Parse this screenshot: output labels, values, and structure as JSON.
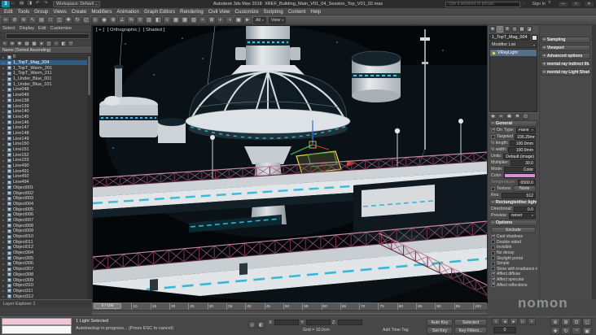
{
  "titlebar": {
    "workspace_label": "Workspace: Default",
    "app_title": "Autodesk 3ds Max 2018",
    "file_name": "XREF_Building_Main_V01_04_Session_Top_V01_02.max",
    "search_placeholder": "Type a keyword or phrase",
    "signin_label": "Sign In",
    "help_label": "?",
    "window_buttons": {
      "minimize": "—",
      "maximize": "□",
      "close": "✕"
    },
    "quick_icons": [
      {
        "name": "new-scene-icon",
        "glyph": "□"
      },
      {
        "name": "open-file-icon",
        "glyph": "▤"
      },
      {
        "name": "save-file-icon",
        "glyph": "◨"
      },
      {
        "name": "undo-icon",
        "glyph": "↶"
      },
      {
        "name": "redo-icon",
        "glyph": "↷"
      }
    ]
  },
  "menubar": {
    "items": [
      "Edit",
      "Tools",
      "Group",
      "Views",
      "Create",
      "Modifiers",
      "Animation",
      "Graph Editors",
      "Rendering",
      "Civil View",
      "Customize",
      "Scripting",
      "Content",
      "Help"
    ]
  },
  "main_toolbar": {
    "selection_filter_value": "All",
    "coord_system_value": "View",
    "icons": [
      {
        "name": "select-and-link-icon",
        "glyph": "∞"
      },
      {
        "name": "unlink-selection-icon",
        "glyph": "⊘"
      },
      {
        "name": "bind-to-space-warp-icon",
        "glyph": "≋"
      },
      {
        "name": "select-object-icon",
        "glyph": "↖"
      },
      {
        "name": "select-by-name-icon",
        "glyph": "▤"
      },
      {
        "name": "selection-region-icon",
        "glyph": "□"
      },
      {
        "name": "window-crossing-icon",
        "glyph": "◫"
      },
      {
        "name": "select-and-move-icon",
        "glyph": "✚"
      },
      {
        "name": "select-and-rotate-icon",
        "glyph": "↻"
      },
      {
        "name": "select-and-scale-icon",
        "glyph": "◱"
      },
      {
        "name": "use-pivot-center-icon",
        "glyph": "◎"
      },
      {
        "name": "select-and-manipulate-icon",
        "glyph": "◉"
      },
      {
        "name": "snaps-toggle-icon",
        "glyph": "⊕"
      },
      {
        "name": "angle-snap-icon",
        "glyph": "∠"
      },
      {
        "name": "percent-snap-icon",
        "glyph": "%"
      },
      {
        "name": "spinner-snap-icon",
        "glyph": "⊙"
      },
      {
        "name": "named-selection-sets-icon",
        "glyph": "▥"
      },
      {
        "name": "mirror-icon",
        "glyph": "◧"
      },
      {
        "name": "align-icon",
        "glyph": "≡"
      },
      {
        "name": "scene-explorer-toggle-icon",
        "glyph": "▦"
      },
      {
        "name": "layer-explorer-toggle-icon",
        "glyph": "▩"
      },
      {
        "name": "ribbon-toggle-icon",
        "glyph": "▨"
      },
      {
        "name": "curve-editor-icon",
        "glyph": "≈"
      },
      {
        "name": "schematic-view-icon",
        "glyph": "⊞"
      },
      {
        "name": "material-editor-icon",
        "glyph": "◐"
      },
      {
        "name": "render-setup-icon",
        "glyph": "◑"
      },
      {
        "name": "rendered-frame-window-icon",
        "glyph": "▣"
      },
      {
        "name": "render-production-icon",
        "glyph": "►"
      }
    ]
  },
  "scene_explorer": {
    "menu_items": [
      "Select",
      "Display",
      "Edit",
      "Customize"
    ],
    "column_header": "Name (Sorted Ascending)",
    "footer_tab": "Layer Explorer 1",
    "tool_icons": [
      {
        "name": "se-pick-icon",
        "glyph": "↖"
      },
      {
        "name": "se-add-layer-icon",
        "glyph": "⊕"
      },
      {
        "name": "se-delete-icon",
        "glyph": "✖"
      },
      {
        "name": "se-show-all-icon",
        "glyph": "▤"
      },
      {
        "name": "se-show-geometry-icon",
        "glyph": "▦"
      },
      {
        "name": "se-show-lights-icon",
        "glyph": "●"
      },
      {
        "name": "se-show-cameras-icon",
        "glyph": "◫"
      },
      {
        "name": "se-show-helpers-icon",
        "glyph": "○"
      },
      {
        "name": "se-show-shapes-icon",
        "glyph": "◧"
      },
      {
        "name": "se-filter-icon",
        "glyph": "▽"
      }
    ],
    "rows": [
      {
        "name": "0",
        "selected": false
      },
      {
        "name": "1_TopT_Mag_204",
        "selected": true
      },
      {
        "name": "1_TopT_Warm_201",
        "selected": false
      },
      {
        "name": "1_TopT_Warm_211",
        "selected": false
      },
      {
        "name": "1_Under_Blue_001",
        "selected": false
      },
      {
        "name": "1_Under_Blue_101",
        "selected": false
      },
      {
        "name": "Line048",
        "selected": false
      },
      {
        "name": "Line049",
        "selected": false
      },
      {
        "name": "Line138",
        "selected": false
      },
      {
        "name": "Line139",
        "selected": false
      },
      {
        "name": "Line140",
        "selected": false
      },
      {
        "name": "Line145",
        "selected": false
      },
      {
        "name": "Line146",
        "selected": false
      },
      {
        "name": "Line147",
        "selected": false
      },
      {
        "name": "Line148",
        "selected": false
      },
      {
        "name": "Line149",
        "selected": false
      },
      {
        "name": "Line150",
        "selected": false
      },
      {
        "name": "Line151",
        "selected": false
      },
      {
        "name": "Line152",
        "selected": false
      },
      {
        "name": "Line153",
        "selected": false
      },
      {
        "name": "Line490",
        "selected": false
      },
      {
        "name": "Line491",
        "selected": false
      },
      {
        "name": "Line492",
        "selected": false
      },
      {
        "name": "Line494",
        "selected": false
      },
      {
        "name": "Object001",
        "selected": false
      },
      {
        "name": "Object002",
        "selected": false
      },
      {
        "name": "Object003",
        "selected": false
      },
      {
        "name": "Object004",
        "selected": false
      },
      {
        "name": "Object005",
        "selected": false
      },
      {
        "name": "Object006",
        "selected": false
      },
      {
        "name": "Object007",
        "selected": false
      },
      {
        "name": "Object008",
        "selected": false
      },
      {
        "name": "Object009",
        "selected": false
      },
      {
        "name": "Object010",
        "selected": false
      },
      {
        "name": "Object011",
        "selected": false
      },
      {
        "name": "Object012",
        "selected": false
      },
      {
        "name": "Object304",
        "selected": false
      },
      {
        "name": "Object305",
        "selected": false
      },
      {
        "name": "Object306",
        "selected": false
      },
      {
        "name": "Object307",
        "selected": false
      },
      {
        "name": "Object308",
        "selected": false
      },
      {
        "name": "Object309",
        "selected": false
      },
      {
        "name": "Object310",
        "selected": false
      },
      {
        "name": "Object311",
        "selected": false
      },
      {
        "name": "Object312",
        "selected": false
      }
    ]
  },
  "viewport": {
    "label_menu": "[ + ]",
    "label_view": "[ Orthographic ]",
    "label_shading": "[ Shaded ]"
  },
  "command_panel": {
    "object_name": "1_TopT_Mag_004",
    "modifier_list_label": "Modifier List",
    "tabs": [
      {
        "name": "tab-create",
        "glyph": "✚",
        "active": false
      },
      {
        "name": "tab-modify",
        "glyph": "≈",
        "active": true
      },
      {
        "name": "tab-hierarchy",
        "glyph": "≣",
        "active": false
      },
      {
        "name": "tab-motion",
        "glyph": "◎",
        "active": false
      },
      {
        "name": "tab-display",
        "glyph": "▦",
        "active": false
      },
      {
        "name": "tab-utilities",
        "glyph": "◪",
        "active": false
      }
    ],
    "stack_items": [
      {
        "label": "VRayLight",
        "selected": true
      }
    ],
    "stack_tools": [
      {
        "name": "pin-stack-icon",
        "glyph": "◉"
      },
      {
        "name": "show-end-result-icon",
        "glyph": "≡"
      },
      {
        "name": "make-unique-icon",
        "glyph": "▣"
      },
      {
        "name": "remove-modifier-icon",
        "glyph": "✖"
      },
      {
        "name": "configure-modifier-sets-icon",
        "glyph": "◫"
      }
    ],
    "rollout_general": {
      "title": "General",
      "on_label": "On",
      "type_label": "Type:",
      "type_value": "Plane",
      "targeted_label": "Targeted",
      "targeted_value": "236.29mm",
      "len_label": "½ length:",
      "len_value": "100.0mm",
      "wid_label": "½ width:",
      "wid_value": "100.0mm",
      "rows": [
        {
          "label": "Units:",
          "value": "Default (image)"
        },
        {
          "label": "Multiplier:",
          "value": "30.0"
        },
        {
          "label": "Mode:",
          "value": "Color"
        }
      ],
      "color_label": "Color:",
      "temperature_label": "Temperature:",
      "temperature_value": "6500.0",
      "texture_label": "Texture:",
      "texture_button": "None",
      "res_label": "Res:",
      "res_value": "512"
    },
    "rollout_rect": {
      "title": "Rectangle/disc light",
      "dir_label": "Directional:",
      "dir_value": "0.0",
      "preview_label": "Preview:",
      "preview_value": "Never"
    },
    "rollout_options": {
      "title": "Options",
      "exclude_label": "Exclude",
      "checks": [
        {
          "label": "Cast shadows",
          "checked": true
        },
        {
          "label": "Double-sided",
          "checked": false
        },
        {
          "label": "Invisible",
          "checked": false
        },
        {
          "label": "No decay",
          "checked": false
        },
        {
          "label": "Skylight portal",
          "checked": false
        },
        {
          "label": "Simple",
          "checked": false
        },
        {
          "label": "Store with irradiance map",
          "checked": false
        },
        {
          "label": "Affect diffuse",
          "checked": true
        },
        {
          "label": "Affect specular",
          "checked": true
        },
        {
          "label": "Affect reflections",
          "checked": true
        }
      ]
    },
    "second_column_rollouts": [
      "Sampling",
      "Viewport",
      "Advanced options",
      "mental ray Indirect Illumination",
      "mental ray Light Shader"
    ]
  },
  "timeline": {
    "slider_label": "0 / 100",
    "ticks": [
      "0",
      "5",
      "10",
      "15",
      "20",
      "25",
      "30",
      "35",
      "40",
      "45",
      "50",
      "55",
      "60",
      "65",
      "70",
      "75",
      "80",
      "85",
      "90",
      "95",
      "100"
    ]
  },
  "status_bar": {
    "selected_info": "1 Light Selected",
    "status_message": "Autobackup in progress... (Press ESC to cancel)",
    "x_label": "X:",
    "y_label": "Y:",
    "z_label": "Z:",
    "grid_label": "Grid = 10.0cm",
    "add_time_tag": "Add Time Tag",
    "auto_key": "Auto Key",
    "selection_set": "Selected",
    "set_key": "Set Key",
    "key_filters": "Key Filters...",
    "frame_value": "0",
    "playback_icons": [
      {
        "name": "go-to-start-icon",
        "glyph": "«"
      },
      {
        "name": "previous-frame-icon",
        "glyph": "◄"
      },
      {
        "name": "play-icon",
        "glyph": "►"
      },
      {
        "name": "next-frame-icon",
        "glyph": "▷"
      },
      {
        "name": "go-to-end-icon",
        "glyph": "»"
      }
    ],
    "nav_icons": [
      {
        "name": "zoom-icon",
        "glyph": "⊕"
      },
      {
        "name": "zoom-all-icon",
        "glyph": "⊞"
      },
      {
        "name": "zoom-extents-icon",
        "glyph": "⊡"
      },
      {
        "name": "zoom-region-icon",
        "glyph": "◱"
      },
      {
        "name": "pan-icon",
        "glyph": "✚"
      },
      {
        "name": "orbit-icon",
        "glyph": "↻"
      },
      {
        "name": "fov-icon",
        "glyph": "◔"
      },
      {
        "name": "maximize-viewport-icon",
        "glyph": "▣"
      }
    ]
  },
  "watermark": "nomon",
  "colors": {
    "light_color": "#d98fd4",
    "accent_cyan": "#38b7d5",
    "railing_pink": "#9e5c72",
    "selection_yellow": "#e9d64e"
  }
}
